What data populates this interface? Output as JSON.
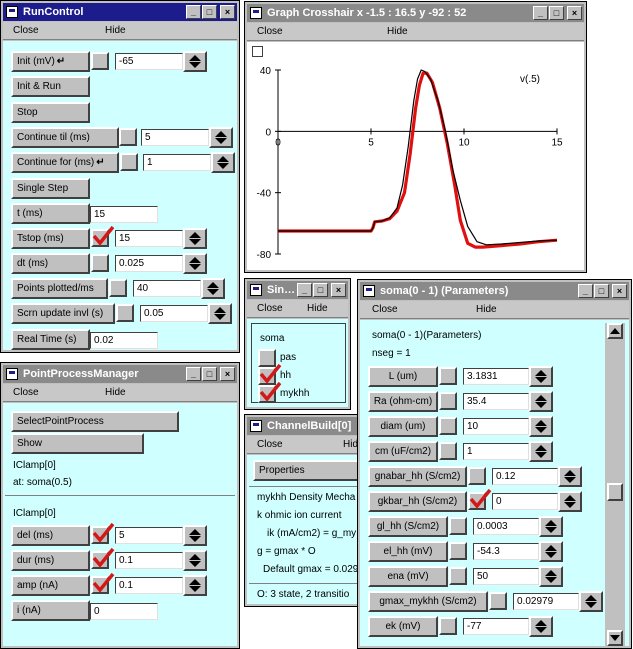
{
  "common": {
    "close": "Close",
    "hide": "Hide"
  },
  "run_control": {
    "title": "RunControl",
    "init_label": "Init (mV)",
    "init_value": "-65",
    "init_run": "Init & Run",
    "stop": "Stop",
    "continue_til_label": "Continue til (ms)",
    "continue_til_value": "5",
    "continue_for_label": "Continue for (ms)",
    "continue_for_value": "1",
    "single_step": "Single Step",
    "t_label": "t (ms)",
    "t_value": "15",
    "tstop_label": "Tstop (ms)",
    "tstop_value": "15",
    "dt_label": "dt (ms)",
    "dt_value": "0.025",
    "points_label": "Points plotted/ms",
    "points_value": "40",
    "scrn_label": "Scrn update invl (s)",
    "scrn_value": "0.05",
    "realtime_label": "Real Time (s)",
    "realtime_value": "0.02"
  },
  "graph": {
    "title": "Graph Crosshair x -1.5 : 16.5  y -92 : 52",
    "series_label": "v(.5)"
  },
  "chart_data": {
    "type": "line",
    "title": "",
    "xlabel": "",
    "ylabel": "",
    "xlim": [
      0,
      15
    ],
    "ylim": [
      -80,
      40
    ],
    "x_ticks": [
      "0",
      "5",
      "10",
      "15"
    ],
    "y_ticks": [
      "40",
      "0",
      "-40",
      "-80"
    ],
    "series": [
      {
        "name": "v(.5)",
        "color": "#e01010",
        "points": [
          [
            0,
            -65
          ],
          [
            5,
            -65
          ],
          [
            5.1,
            -63
          ],
          [
            5.2,
            -59
          ],
          [
            5.6,
            -58.5
          ],
          [
            6.0,
            -57
          ],
          [
            6.4,
            -52
          ],
          [
            6.8,
            -40
          ],
          [
            7.1,
            -15
          ],
          [
            7.4,
            15
          ],
          [
            7.6,
            30
          ],
          [
            7.8,
            38
          ],
          [
            8.0,
            38
          ],
          [
            8.3,
            32
          ],
          [
            8.7,
            15
          ],
          [
            9.1,
            -8
          ],
          [
            9.5,
            -35
          ],
          [
            9.8,
            -58
          ],
          [
            10.2,
            -73
          ],
          [
            10.6,
            -75.5
          ],
          [
            11,
            -75.5
          ],
          [
            12,
            -74.5
          ],
          [
            13,
            -73.5
          ],
          [
            14,
            -72
          ],
          [
            15,
            -71
          ]
        ]
      },
      {
        "color": "#000000",
        "points": [
          [
            0,
            -65
          ],
          [
            5,
            -65
          ],
          [
            5.1,
            -63
          ],
          [
            5.2,
            -59
          ],
          [
            5.6,
            -58.5
          ],
          [
            6.0,
            -56.5
          ],
          [
            6.4,
            -50
          ],
          [
            6.7,
            -35
          ],
          [
            7.0,
            -10
          ],
          [
            7.3,
            20
          ],
          [
            7.5,
            34
          ],
          [
            7.7,
            40
          ],
          [
            7.9,
            39
          ],
          [
            8.2,
            34
          ],
          [
            8.6,
            20
          ],
          [
            9.0,
            0
          ],
          [
            9.4,
            -25
          ],
          [
            9.8,
            -45
          ],
          [
            10.2,
            -62
          ],
          [
            10.7,
            -72
          ],
          [
            11.2,
            -74
          ],
          [
            12,
            -73.5
          ],
          [
            13,
            -72.5
          ],
          [
            14,
            -71.5
          ],
          [
            15,
            -71
          ]
        ]
      }
    ]
  },
  "single_compartment": {
    "title": "Sin…",
    "section": "soma",
    "items": [
      {
        "label": "pas",
        "checked": false
      },
      {
        "label": "hh",
        "checked": true
      },
      {
        "label": "mykhh",
        "checked": true
      }
    ]
  },
  "ppm": {
    "title": "PointProcessManager",
    "select": "SelectPointProcess",
    "show": "Show",
    "iclamp_name": "IClamp[0]",
    "location": "at: soma(0.5)",
    "iclamp_name2": "IClamp[0]",
    "del_label": "del (ms)",
    "del_value": "5",
    "dur_label": "dur (ms)",
    "dur_value": "0.1",
    "amp_label": "amp (nA)",
    "amp_value": "0.1",
    "i_label": "i (nA)",
    "i_value": "0"
  },
  "channelbuild": {
    "title": "ChannelBuild[0]",
    "hide_partial": "Hid",
    "properties": "Properties",
    "desc1": "mykhh Density Mecha",
    "desc2": "k ohmic ion current",
    "desc3": "ik (mA/cm2) = g_my",
    "desc4": "g = gmax * O",
    "desc5": "Default gmax = 0.029",
    "status": "O: 3 state, 2 transitio"
  },
  "soma": {
    "title": "soma(0 - 1) (Parameters)",
    "heading": "soma(0 - 1)(Parameters)",
    "nseg": "nseg = 1",
    "params": [
      {
        "label": "L (um)",
        "value": "3.1831",
        "checked": false
      },
      {
        "label": "Ra (ohm-cm)",
        "value": "35.4",
        "checked": false
      },
      {
        "label": "diam (um)",
        "value": "10",
        "checked": false
      },
      {
        "label": "cm (uF/cm2)",
        "value": "1",
        "checked": false
      },
      {
        "label": "gnabar_hh (S/cm2)",
        "value": "0.12",
        "checked": false
      },
      {
        "label": "gkbar_hh (S/cm2)",
        "value": "0",
        "checked": true
      },
      {
        "label": "gl_hh (S/cm2)",
        "value": "0.0003",
        "checked": false
      },
      {
        "label": "el_hh (mV)",
        "value": "-54.3",
        "checked": false
      },
      {
        "label": "ena (mV)",
        "value": "50",
        "checked": false
      },
      {
        "label": "gmax_mykhh (S/cm2)",
        "value": "0.02979",
        "checked": false
      },
      {
        "label": "ek (mV)",
        "value": "-77",
        "checked": false
      }
    ]
  }
}
